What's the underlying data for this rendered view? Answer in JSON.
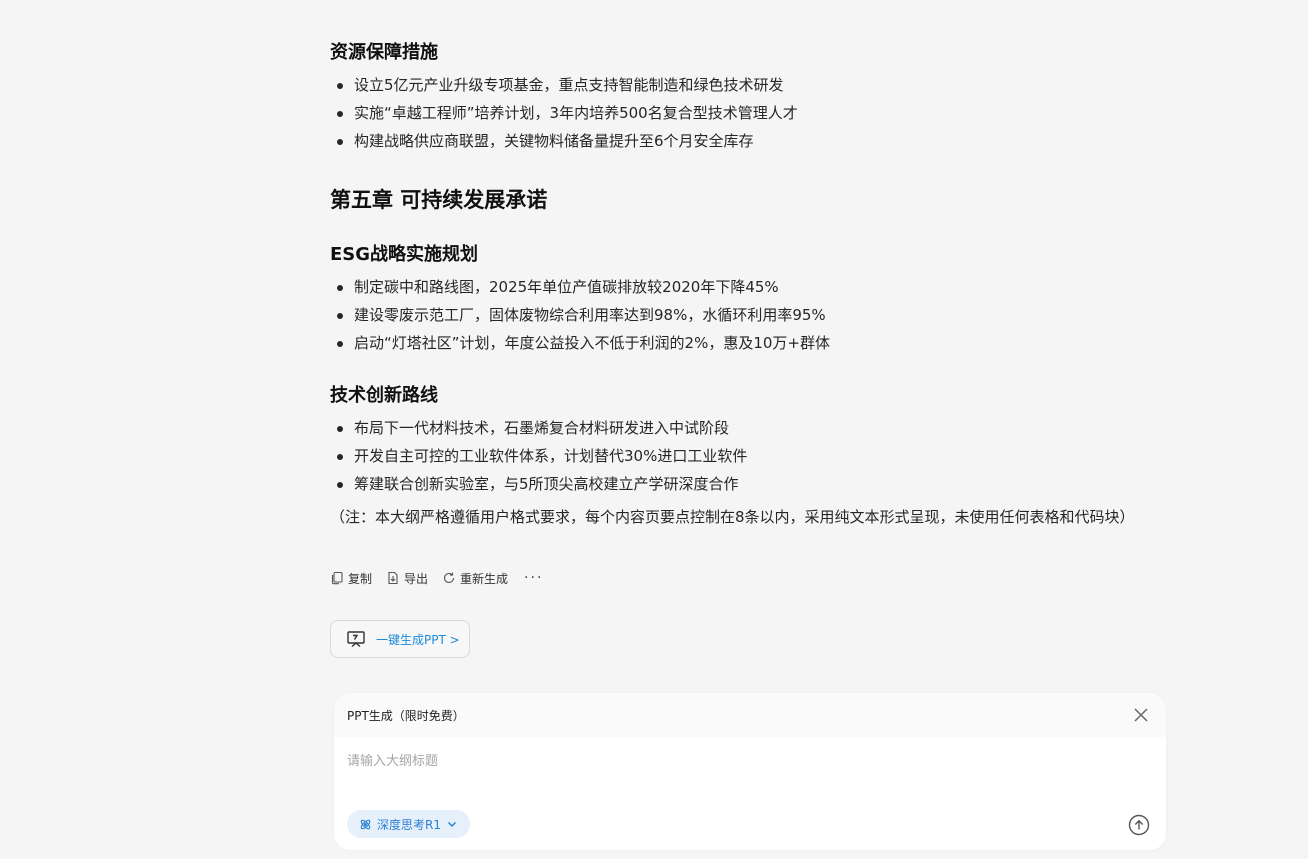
{
  "doc": {
    "section1": {
      "heading": "资源保障措施",
      "items": [
        "设立5亿元产业升级专项基金，重点支持智能制造和绿色技术研发",
        "实施“卓越工程师”培养计划，3年内培养500名复合型技术管理人才",
        "构建战略供应商联盟，关键物料储备量提升至6个月安全库存"
      ]
    },
    "chapter5": {
      "heading": "第五章 可持续发展承诺"
    },
    "section2": {
      "heading": "ESG战略实施规划",
      "items": [
        "制定碳中和路线图，2025年单位产值碳排放较2020年下降45%",
        "建设零废示范工厂，固体废物综合利用率达到98%，水循环利用率95%",
        "启动“灯塔社区”计划，年度公益投入不低于利润的2%，惠及10万+群体"
      ]
    },
    "section3": {
      "heading": "技术创新路线",
      "items": [
        "布局下一代材料技术，石墨烯复合材料研发进入中试阶段",
        "开发自主可控的工业软件体系，计划替代30%进口工业软件",
        "筹建联合创新实验室，与5所顶尖高校建立产学研深度合作"
      ]
    },
    "note": "（注：本大纲严格遵循用户格式要求，每个内容页要点控制在8条以内，采用纯文本形式呈现，未使用任何表格和代码块）"
  },
  "actions": {
    "copy": "复制",
    "export": "导出",
    "regenerate": "重新生成",
    "more": "···"
  },
  "ppt_button": {
    "label": "一键生成PPT >"
  },
  "ppt_panel": {
    "title": "PPT生成（限时免费）",
    "input_placeholder": "请输入大纲标题",
    "input_value": "",
    "deep_think_label": "深度思考R1"
  },
  "colors": {
    "background": "#f5f5f5",
    "link_blue": "#1a8cd8",
    "chip_bg": "#e6f0fb",
    "chip_text": "#2b7fd4"
  }
}
